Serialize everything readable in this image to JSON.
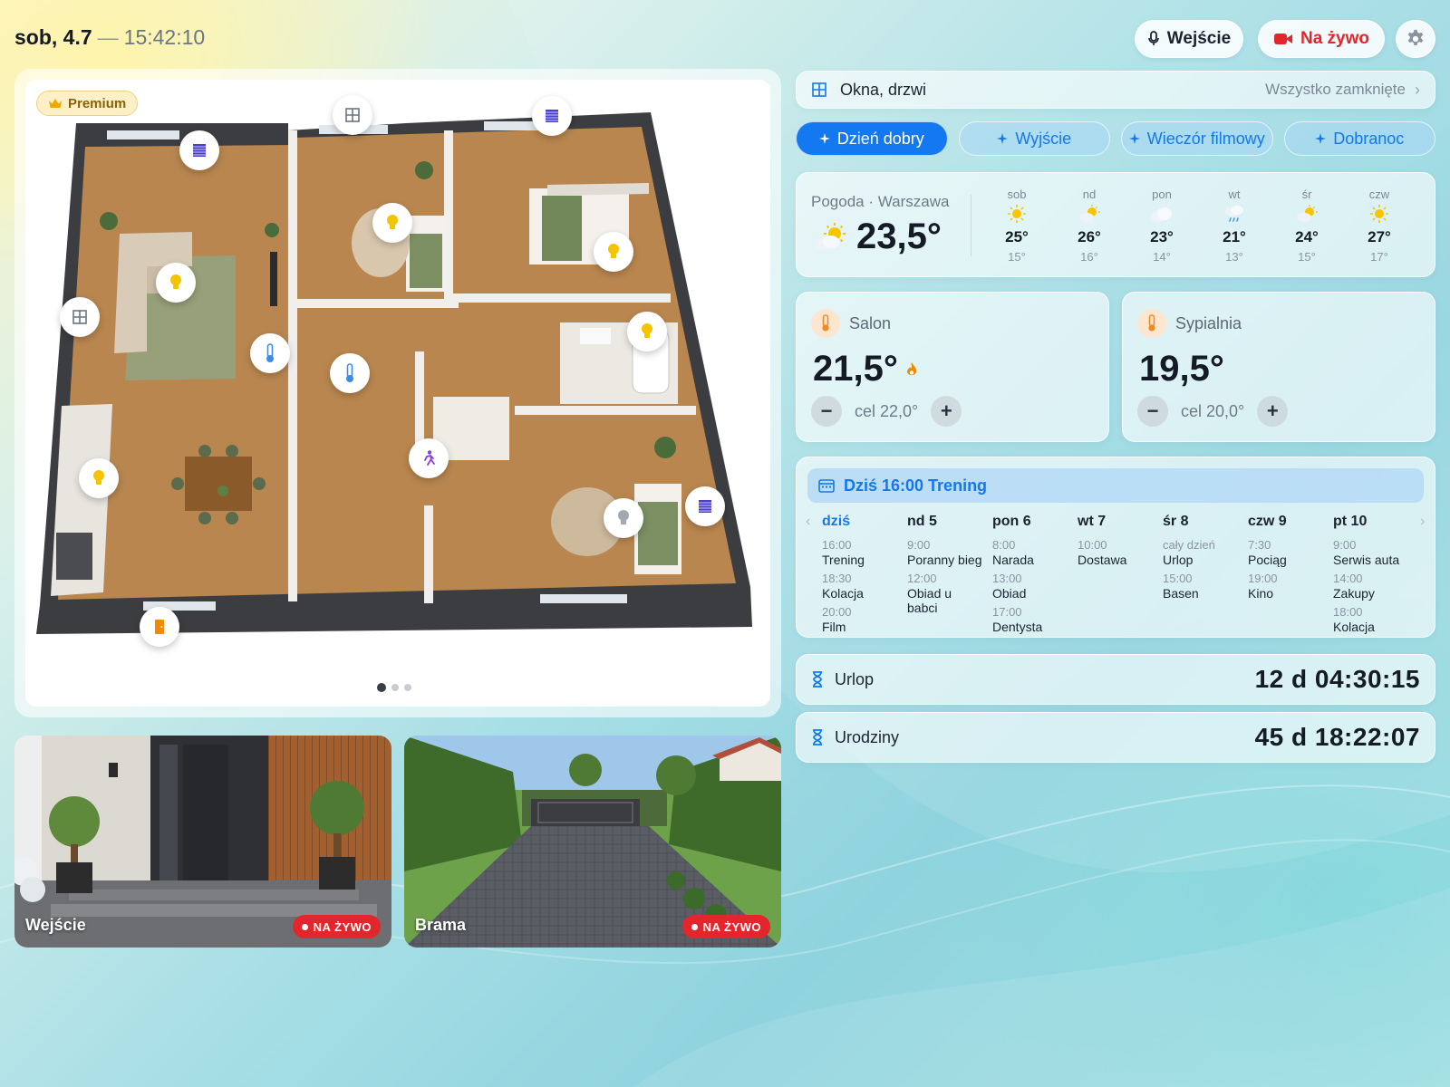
{
  "header": {
    "date": "sob, 4.7",
    "separator": "—",
    "time": "15:42:10",
    "intercom_label": "Wejście",
    "live_label": "Na żywo"
  },
  "floorplan": {
    "badge": "Premium",
    "page_count": 3,
    "active_page": 1,
    "markers": [
      "window",
      "blinds",
      "blinds",
      "window",
      "light",
      "light",
      "light",
      "light",
      "light",
      "light",
      "thermometer",
      "thermometer",
      "motion",
      "door",
      "blinds"
    ]
  },
  "cameras": [
    {
      "label": "Wejście",
      "badge": "NA ŻYWO"
    },
    {
      "label": "Brama",
      "badge": "NA ŻYWO"
    }
  ],
  "openings": {
    "title": "Okna, drzwi",
    "status": "Wszystko zamknięte"
  },
  "scenes": [
    {
      "label": "Dzień dobry",
      "active": true
    },
    {
      "label": "Wyjście",
      "active": false
    },
    {
      "label": "Wieczór filmowy",
      "active": false
    },
    {
      "label": "Dobranoc",
      "active": false
    }
  ],
  "weather": {
    "label": "Pogoda · Warszawa",
    "current_temp": "23,5°",
    "current_icon": "partly-sunny-icon",
    "forecast": [
      {
        "day": "sob",
        "icon": "sun-icon",
        "high": "25°",
        "low": "15°"
      },
      {
        "day": "nd",
        "icon": "partly-sunny-icon",
        "high": "26°",
        "low": "16°"
      },
      {
        "day": "pon",
        "icon": "cloud-icon",
        "high": "23°",
        "low": "14°"
      },
      {
        "day": "wt",
        "icon": "rain-icon",
        "high": "21°",
        "low": "13°"
      },
      {
        "day": "śr",
        "icon": "partly-sunny-icon",
        "high": "24°",
        "low": "15°"
      },
      {
        "day": "czw",
        "icon": "sun-icon",
        "high": "27°",
        "low": "17°"
      }
    ]
  },
  "rooms": [
    {
      "name": "Salon",
      "temp": "21,5°",
      "heating": true,
      "target": "cel 22,0°"
    },
    {
      "name": "Sypialnia",
      "temp": "19,5°",
      "heating": false,
      "target": "cel 20,0°"
    }
  ],
  "agenda": {
    "headline": "Dziś 16:00 Trening",
    "days": [
      {
        "label": "dziś",
        "today": true,
        "events": [
          {
            "time": "16:00",
            "name": "Trening"
          },
          {
            "time": "18:30",
            "name": "Kolacja"
          },
          {
            "time": "20:00",
            "name": "Film"
          }
        ]
      },
      {
        "label": "nd 5",
        "today": false,
        "events": [
          {
            "time": "9:00",
            "name": "Poranny bieg"
          },
          {
            "time": "12:00",
            "name": "Obiad u babci"
          }
        ]
      },
      {
        "label": "pon 6",
        "today": false,
        "events": [
          {
            "time": "8:00",
            "name": "Narada"
          },
          {
            "time": "13:00",
            "name": "Obiad"
          },
          {
            "time": "17:00",
            "name": "Dentysta"
          }
        ]
      },
      {
        "label": "wt 7",
        "today": false,
        "events": [
          {
            "time": "10:00",
            "name": "Dostawa"
          }
        ]
      },
      {
        "label": "śr 8",
        "today": false,
        "events": [
          {
            "time": "cały dzień",
            "name": "Urlop"
          },
          {
            "time": "15:00",
            "name": "Basen"
          }
        ]
      },
      {
        "label": "czw 9",
        "today": false,
        "events": [
          {
            "time": "7:30",
            "name": "Pociąg"
          },
          {
            "time": "19:00",
            "name": "Kino"
          }
        ]
      },
      {
        "label": "pt 10",
        "today": false,
        "events": [
          {
            "time": "9:00",
            "name": "Serwis auta"
          },
          {
            "time": "14:00",
            "name": "Zakupy"
          },
          {
            "time": "18:00",
            "name": "Kolacja"
          }
        ]
      }
    ]
  },
  "countdowns": [
    {
      "name": "Urlop",
      "value": "12 d 04:30:15"
    },
    {
      "name": "Urodziny",
      "value": "45 d 18:22:07"
    }
  ],
  "colors": {
    "accent": "#1478e8",
    "live_red": "#e3262b",
    "premium_gold": "#f0a800"
  }
}
